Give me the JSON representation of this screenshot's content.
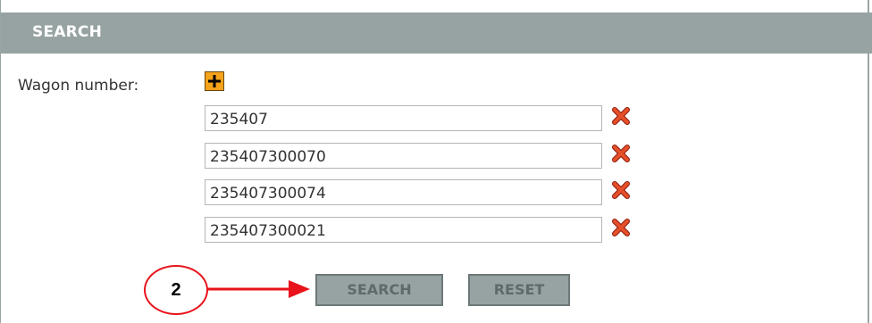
{
  "search_panel": {
    "title": "SEARCH",
    "wagon_number_label": "Wagon number:",
    "add_icon": "plus-icon",
    "remove_icon": "red-x-icon",
    "wagon_numbers": [
      {
        "value": "235407"
      },
      {
        "value": "235407300070"
      },
      {
        "value": "235407300074"
      },
      {
        "value": "235407300021"
      }
    ],
    "search_button_label": "SEARCH",
    "reset_button_label": "RESET"
  },
  "annotation": {
    "step_number": "2",
    "color": "#e8131b"
  },
  "colors": {
    "header_bg": "#97a3a3",
    "add_button": "#f4a21a",
    "remove_icon": "#e04422"
  }
}
